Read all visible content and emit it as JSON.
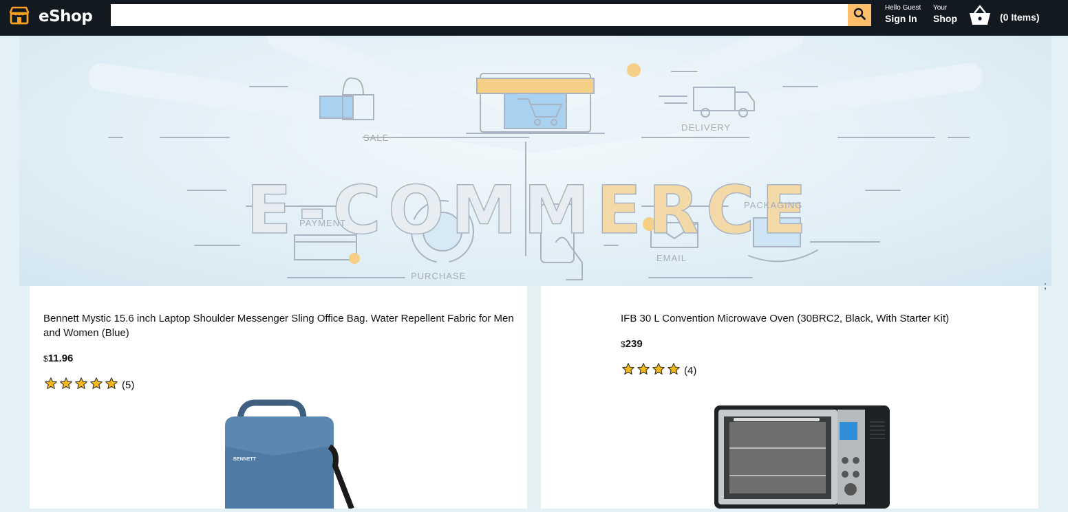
{
  "header": {
    "logo_text": "eShop",
    "search_placeholder": "",
    "account_line1": "Hello Guest",
    "account_line2": "Sign In",
    "shop_line1": "Your",
    "shop_line2": "Shop",
    "basket_count": "(0 Items)",
    "search_button_color": "#febd69",
    "icons": [
      "store-logo-icon",
      "search-icon",
      "basket-icon"
    ]
  },
  "hero": {
    "title_part1": "E-CO",
    "title_part2": "MM",
    "title_part3": "ERCE",
    "labels": {
      "sale": "SALE",
      "delivery": "DELIVERY",
      "payment": "PAYMENT",
      "purchase": "PURCHASE",
      "packaging": "PACKAGING",
      "email": "EMAIL"
    }
  },
  "stray_text": ";",
  "products": [
    {
      "title": "Bennett Mystic 15.6 inch Laptop Shoulder Messenger Sling Office Bag. Water Repellent Fabric for Men and Women (Blue)",
      "currency": "$",
      "price": "11.96",
      "stars": 5,
      "rating_count": "(5)",
      "image_icon": "laptop-bag-image",
      "brand_mark": "BENNETT"
    },
    {
      "title": "IFB 30 L Convention Microwave Oven (30BRC2, Black, With Starter Kit)",
      "currency": "$",
      "price": "239",
      "stars": 4,
      "rating_count": "(4)",
      "image_icon": "oven-image"
    }
  ],
  "colors": {
    "header_bg": "#131921",
    "page_bg": "#e3f0f6",
    "star": "#f5b818"
  }
}
